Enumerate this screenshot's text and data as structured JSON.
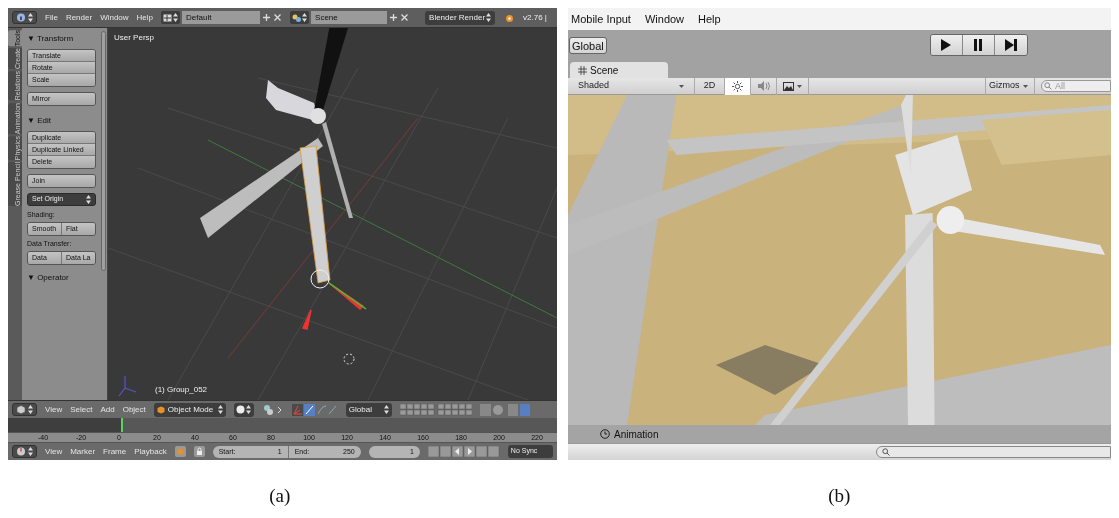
{
  "figure_a": {
    "header": {
      "menus": [
        "File",
        "Render",
        "Window",
        "Help"
      ],
      "layout": "Default",
      "scene": "Scene",
      "engine": "Blender Render",
      "version": "v2.76 |"
    },
    "shelf_tabs": [
      {
        "label": "Tools",
        "selected": true
      },
      {
        "label": "Create",
        "selected": false
      },
      {
        "label": "Relations",
        "selected": false
      },
      {
        "label": "Animation",
        "selected": false
      },
      {
        "label": "Physics",
        "selected": false
      },
      {
        "label": "Grease Pencil",
        "selected": false
      }
    ],
    "tool_shelf": [
      {
        "kind": "heading",
        "label": "▼ Transform"
      },
      {
        "kind": "column",
        "buttons": [
          "Translate",
          "Rotate",
          "Scale"
        ]
      },
      {
        "kind": "column",
        "buttons": [
          "Mirror"
        ]
      },
      {
        "kind": "heading",
        "label": "▼ Edit"
      },
      {
        "kind": "column",
        "buttons": [
          "Duplicate",
          "Duplicate Linked",
          "Delete"
        ]
      },
      {
        "kind": "column",
        "buttons": [
          "Join"
        ]
      },
      {
        "kind": "dropdown",
        "label": "Set Origin"
      },
      {
        "kind": "label",
        "label": "Shading:"
      },
      {
        "kind": "row",
        "buttons": [
          "Smooth",
          "Flat"
        ]
      },
      {
        "kind": "label",
        "label": "Data Transfer:"
      },
      {
        "kind": "row",
        "buttons": [
          "Data",
          "Data La"
        ]
      },
      {
        "kind": "heading",
        "label": "▼ Operator"
      }
    ],
    "viewport": {
      "view_label": "User Persp",
      "object_label": "(1) Group_052"
    },
    "viewport_header": {
      "menus": [
        "View",
        "Select",
        "Add",
        "Object"
      ],
      "mode": "Object Mode",
      "orientation": "Global"
    },
    "timeline": {
      "ruler": [
        "-40",
        "-20",
        "0",
        "20",
        "40",
        "60",
        "80",
        "100",
        "120",
        "140",
        "160",
        "180",
        "200",
        "220"
      ]
    },
    "timeline_header": {
      "menus": [
        "View",
        "Marker",
        "Frame",
        "Playback"
      ],
      "start": {
        "label": "Start:",
        "value": "1"
      },
      "end": {
        "label": "End:",
        "value": "250"
      },
      "current": "1",
      "sync": "No Sync"
    }
  },
  "figure_b": {
    "menus": [
      "Mobile Input",
      "Window",
      "Help"
    ],
    "pivot_button": "Global",
    "tab": {
      "label": "Scene",
      "selected": true
    },
    "scene_toolbar": {
      "draw_mode": "Shaded",
      "mode_2d": "2D",
      "toggles": [
        {
          "kind": "lighting",
          "on": true
        },
        {
          "kind": "audio",
          "on": false
        }
      ],
      "gizmos": "Gizmos",
      "search_placeholder": "All"
    },
    "bottom_tab": "Animation"
  },
  "captions": [
    "(a)",
    "(b)"
  ]
}
